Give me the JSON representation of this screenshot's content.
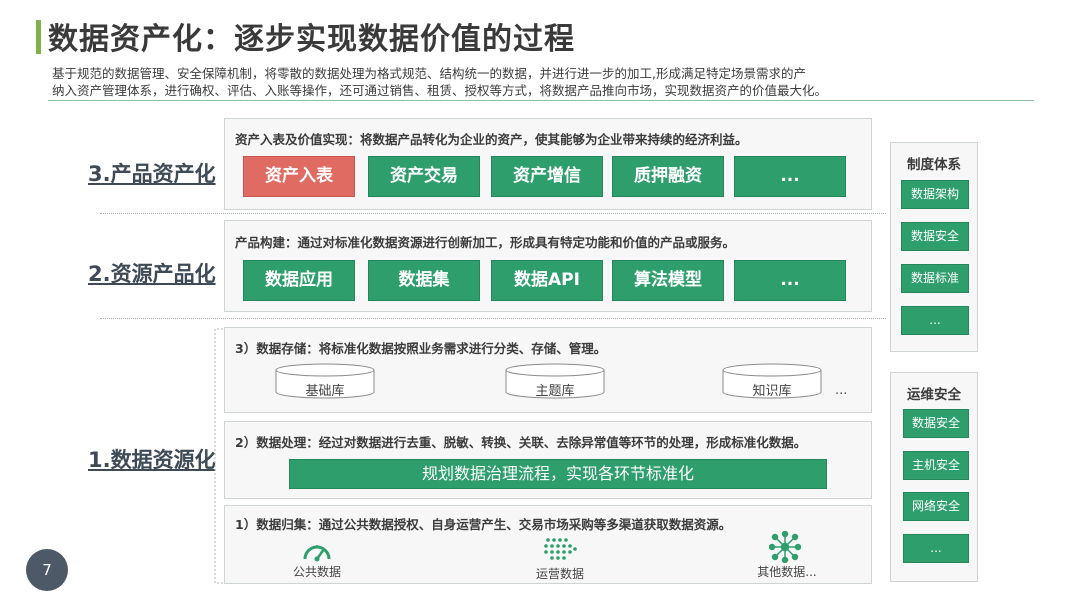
{
  "header": {
    "title": "数据资产化：逐步实现数据价值的过程",
    "desc_line1": "基于规范的数据管理、安全保障机制，将零散的数据处理为格式规范、结构统一的数据，并进行进一步的加工,形成满足特定场景需求的产",
    "desc_line2": "纳入资产管理体系，进行确权、评估、入账等操作，还可通过销售、租赁、授权等方式，将数据产品推向市场，实现数据资产的价值最大化。"
  },
  "layers": {
    "product_assetization": {
      "label": "3.产品资产化",
      "panel_title": "资产入表及价值实现：将数据产品转化为企业的资产，使其能够为企业带来持续的经济利益。",
      "buttons": [
        "资产入表",
        "资产交易",
        "资产增信",
        "质押融资",
        "..."
      ]
    },
    "resource_productization": {
      "label": "2.资源产品化",
      "panel_title": "产品构建：通过对标准化数据资源进行创新加工，形成具有特定功能和价值的产品或服务。",
      "buttons": [
        "数据应用",
        "数据集",
        "数据API",
        "算法模型",
        "..."
      ]
    },
    "data_resourcization": {
      "label": "1.数据资源化",
      "storage": {
        "title": "3）数据存储：将标准化数据按照业务需求进行分类、存储、管理。",
        "items": [
          "基础库",
          "主题库",
          "知识库"
        ],
        "more": "..."
      },
      "processing": {
        "title": "2）数据处理：经过对数据进行去重、脱敏、转换、关联、去除异常值等环节的处理，形成标准化数据。",
        "bar": "规划数据治理流程，实现各环节标准化"
      },
      "collection": {
        "title": "1）数据归集：通过公共数据授权、自身运营产生、交易市场采购等多渠道获取数据资源。",
        "sources": [
          {
            "label": "公共数据",
            "icon": "gauge-icon"
          },
          {
            "label": "运营数据",
            "icon": "dot-grid-icon"
          },
          {
            "label": "其他数据...",
            "icon": "network-icon"
          }
        ]
      }
    }
  },
  "sidebar": {
    "system": {
      "title": "制度体系",
      "items": [
        "数据架构",
        "数据安全",
        "数据标准",
        "..."
      ]
    },
    "ops_security": {
      "title": "运维安全",
      "items": [
        "数据安全",
        "主机安全",
        "网络安全",
        "..."
      ]
    }
  },
  "page_number": "7",
  "colors": {
    "green": "#2e9e6d",
    "red": "#e06b63",
    "title_bar": "#7fb04a"
  }
}
